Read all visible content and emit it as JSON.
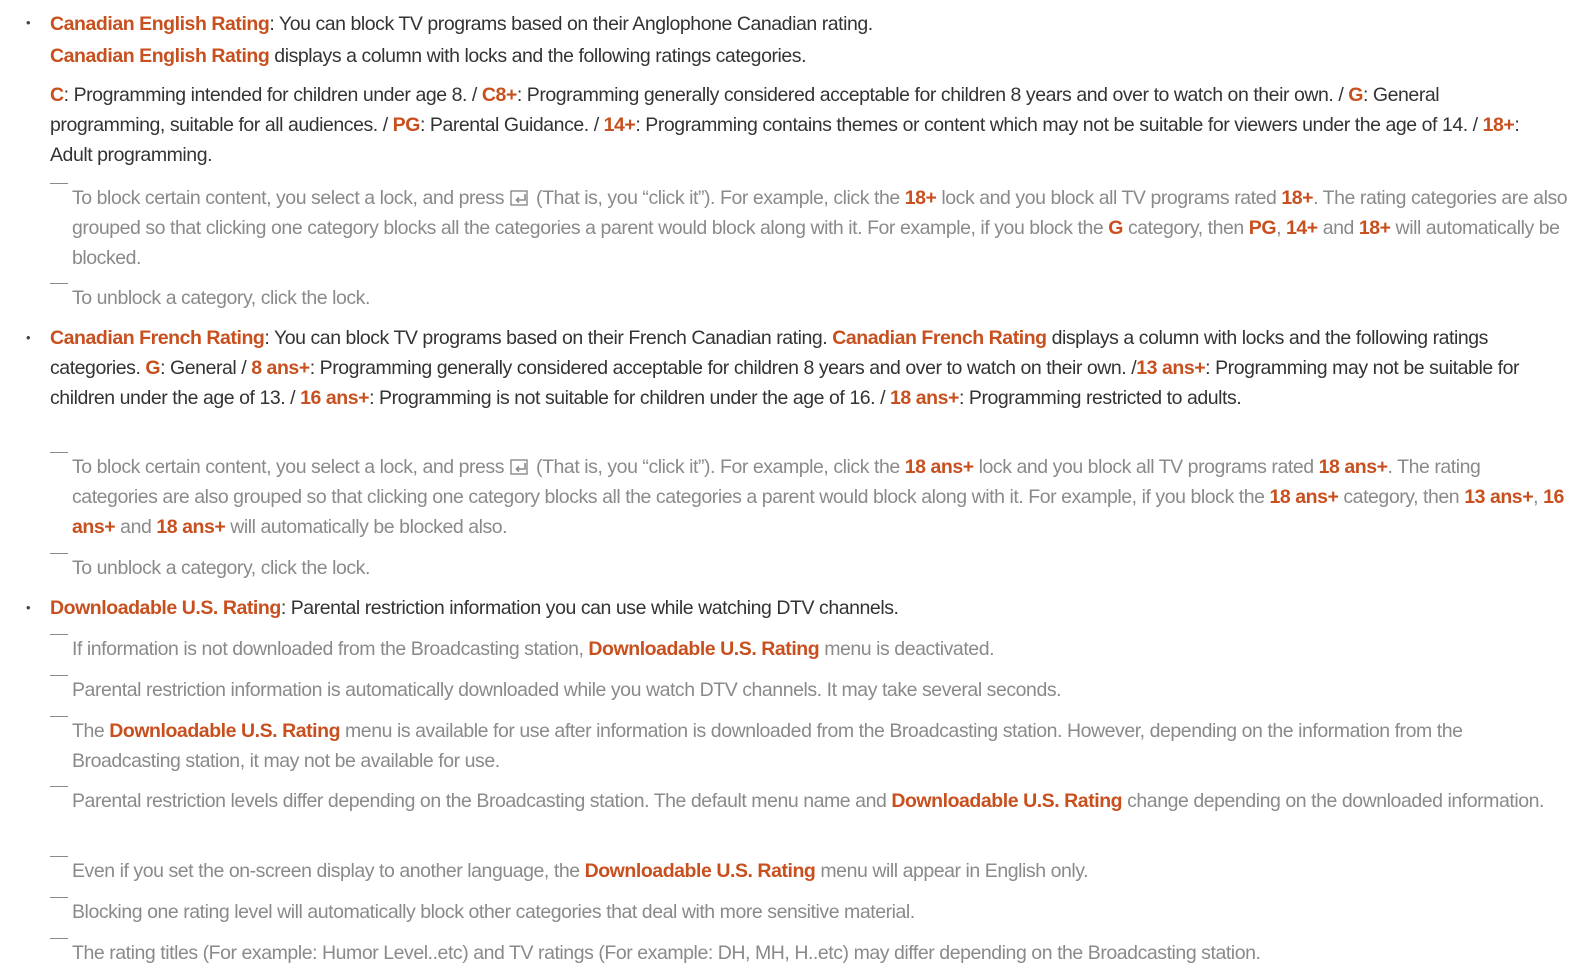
{
  "accent_color": "#c8501f",
  "sections": {
    "canadian_english": {
      "title": "Canadian English Rating",
      "intro": ": You can block TV programs based on their Anglophone Canadian rating.",
      "line2_title": "Canadian English Rating",
      "line2_text": " displays a column with locks and the following ratings categories.",
      "ratings": [
        {
          "key": "C",
          "text": ": Programming intended for children under age 8. / "
        },
        {
          "key": "C8+",
          "text": ": Programming generally considered acceptable for children 8 years and over to watch on their own. / "
        },
        {
          "key": "G",
          "text": ": General programming, suitable for all audiences. / "
        },
        {
          "key": "PG",
          "text": ": Parental Guidance. / "
        },
        {
          "key": "14+",
          "text": ": Programming contains themes or content which may not be suitable for viewers under the age of 14. / "
        },
        {
          "key": "18+",
          "text": ": Adult programming."
        }
      ],
      "note1": {
        "a": "To block certain content, you select a lock, and press",
        "icon": "enter-icon",
        "b": "(That is, you “click it”). For example, click the ",
        "k1": "18+",
        "c": " lock and you block all TV programs rated ",
        "k2": "18+",
        "d": ". The rating categories are also grouped so that clicking one category blocks all the categories a parent would block along with it. For example, if you block the ",
        "k3": "G",
        "e": " category, then ",
        "k4": "PG",
        "f": ", ",
        "k5": "14+",
        "g": " and ",
        "k6": "18+",
        "h": " will automatically be blocked."
      },
      "note2": "To unblock a category, click the lock."
    },
    "canadian_french": {
      "title": "Canadian French Rating",
      "t1": ": You can block TV programs based on their French Canadian rating. ",
      "title2": "Canadian French Rating",
      "t2": " displays a column with locks and the following ratings categories. ",
      "k_g": "G",
      "t3": ": General / ",
      "k_8": "8 ans+",
      "t4": ": Programming generally considered acceptable for children 8 years and over to watch on their own. /",
      "k_13": "13 ans+",
      "t5": ": Programming may not be suitable for children under the age of 13. / ",
      "k_16": "16 ans+",
      "t6": ": Programming is not suitable for children under the age of 16. / ",
      "k_18": "18 ans+",
      "t7": ": Programming restricted to adults.",
      "note1": {
        "a": "To block certain content, you select a lock, and press",
        "icon": "enter-icon",
        "b": "(That is, you “click it”). For example, click the ",
        "k1": "18 ans+",
        "c": " lock and you block all TV programs rated ",
        "k2": "18 ans+",
        "d": ". The rating categories are also grouped so that clicking one category blocks all the categories a parent would block along with it. For example, if you block the ",
        "k3": "18 ans+",
        "e": " category, then ",
        "k4": "13 ans+",
        "f": ", ",
        "k5": "16 ans+",
        "g": " and ",
        "k6": "18 ans+",
        "h": " will automatically be blocked also."
      },
      "note2": "To unblock a category, click the lock."
    },
    "downloadable_us": {
      "title": "Downloadable U.S. Rating",
      "intro": ": Parental restriction information you can use while watching DTV channels.",
      "notes": [
        {
          "a": "If information is not downloaded from the Broadcasting station, ",
          "k": "Downloadable U.S. Rating",
          "b": " menu is deactivated."
        },
        {
          "a": "Parental restriction information is automatically downloaded while you watch DTV channels. It may take several seconds.",
          "k": "",
          "b": ""
        },
        {
          "a": "The ",
          "k": "Downloadable U.S. Rating",
          "b": " menu is available for use after information is downloaded from the Broadcasting station. However, depending on the information from the Broadcasting station, it may not be available for use."
        },
        {
          "a": "Parental restriction levels differ depending on the Broadcasting station. The default menu name and ",
          "k": "Downloadable U.S. Rating",
          "b": " change depending on the downloaded information."
        },
        {
          "a": "Even if you set the on-screen display to another language, the ",
          "k": "Downloadable U.S. Rating",
          "b": " menu will appear in English only."
        },
        {
          "a": "Blocking one rating level will automatically block other categories that deal with more sensitive material.",
          "k": "",
          "b": ""
        },
        {
          "a": "The rating titles (For example: Humor Level..etc) and TV ratings (For example: DH, MH, H..etc) may differ depending on the Broadcasting station.",
          "k": "",
          "b": ""
        }
      ]
    }
  }
}
